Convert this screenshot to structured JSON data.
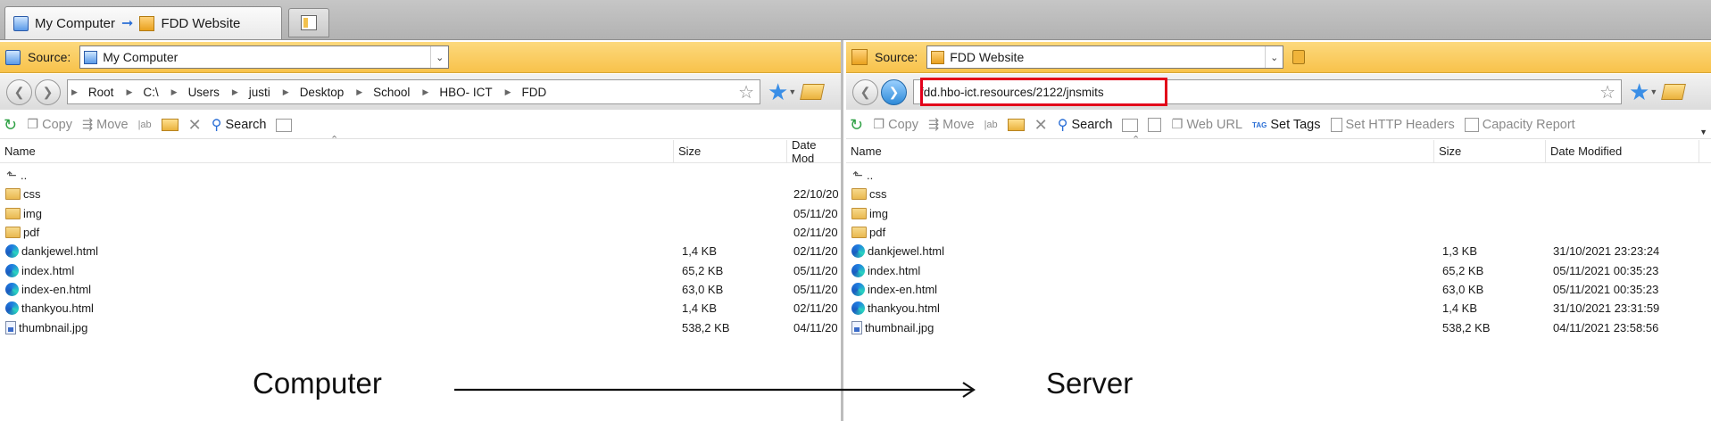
{
  "tabs": [
    {
      "label_from": "My Computer",
      "label_to": "FDD Website"
    }
  ],
  "left": {
    "source_label": "Source:",
    "source_value": "My Computer",
    "breadcrumb": [
      "Root",
      "C:\\",
      "Users",
      "justi",
      "Desktop",
      "School",
      "HBO- ICT",
      "FDD"
    ],
    "toolbar": {
      "copy": "Copy",
      "move": "Move",
      "search": "Search"
    },
    "columns": {
      "name": "Name",
      "size": "Size",
      "date": "Date Mod"
    },
    "rows": [
      {
        "name": "..",
        "size": "",
        "date": "",
        "kind": "up"
      },
      {
        "name": "css",
        "size": "",
        "date": "22/10/20",
        "kind": "folder"
      },
      {
        "name": "img",
        "size": "",
        "date": "05/11/20",
        "kind": "folder"
      },
      {
        "name": "pdf",
        "size": "",
        "date": "02/11/20",
        "kind": "folder"
      },
      {
        "name": "dankjewel.html",
        "size": "1,4 KB",
        "date": "02/11/20",
        "kind": "html"
      },
      {
        "name": "index.html",
        "size": "65,2 KB",
        "date": "05/11/20",
        "kind": "html"
      },
      {
        "name": "index-en.html",
        "size": "63,0 KB",
        "date": "05/11/20",
        "kind": "html"
      },
      {
        "name": "thankyou.html",
        "size": "1,4 KB",
        "date": "02/11/20",
        "kind": "html"
      },
      {
        "name": "thumbnail.jpg",
        "size": "538,2 KB",
        "date": "04/11/20",
        "kind": "jpg"
      }
    ]
  },
  "right": {
    "source_label": "Source:",
    "source_value": "FDD Website",
    "address": "fdd.hbo-ict.resources/2122/jnsmits",
    "toolbar": {
      "copy": "Copy",
      "move": "Move",
      "search": "Search",
      "web_url": "Web URL",
      "set_tags": "Set Tags",
      "set_http_headers": "Set HTTP Headers",
      "capacity_report": "Capacity Report"
    },
    "columns": {
      "name": "Name",
      "size": "Size",
      "date": "Date Modified"
    },
    "rows": [
      {
        "name": "..",
        "size": "",
        "date": "",
        "kind": "up"
      },
      {
        "name": "css",
        "size": "",
        "date": "",
        "kind": "folder"
      },
      {
        "name": "img",
        "size": "",
        "date": "",
        "kind": "folder"
      },
      {
        "name": "pdf",
        "size": "",
        "date": "",
        "kind": "folder"
      },
      {
        "name": "dankjewel.html",
        "size": "1,3 KB",
        "date": "31/10/2021 23:23:24",
        "kind": "html"
      },
      {
        "name": "index.html",
        "size": "65,2 KB",
        "date": "05/11/2021 00:35:23",
        "kind": "html"
      },
      {
        "name": "index-en.html",
        "size": "63,0 KB",
        "date": "05/11/2021 00:35:23",
        "kind": "html"
      },
      {
        "name": "thankyou.html",
        "size": "1,4 KB",
        "date": "31/10/2021 23:31:59",
        "kind": "html"
      },
      {
        "name": "thumbnail.jpg",
        "size": "538,2 KB",
        "date": "04/11/2021 23:58:56",
        "kind": "jpg"
      }
    ]
  },
  "annotation": {
    "from": "Computer",
    "to": "Server",
    "highlight_color": "#e2001a"
  }
}
